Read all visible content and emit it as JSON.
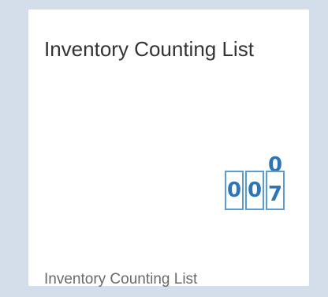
{
  "tile": {
    "title": "Inventory Counting List",
    "footer": "Inventory Counting List"
  },
  "counter": {
    "icon": "counter-icon",
    "digits": [
      "0",
      "0"
    ],
    "rolling_top": "0",
    "rolling_main": "7",
    "accent_color": "#2e75b6",
    "border_color": "#5b9bd5"
  },
  "colors": {
    "background": "#d3deea",
    "tile": "#ffffff",
    "title_text": "#333333",
    "footer_text": "#6a6a6a"
  }
}
